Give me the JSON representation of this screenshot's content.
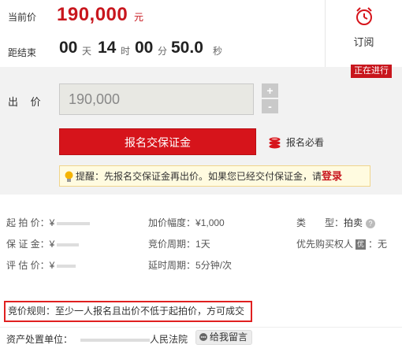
{
  "price": {
    "label": "当前价",
    "value": "190,000",
    "unit": "元"
  },
  "countdown": {
    "label": "距结束",
    "days": "00",
    "days_unit": "天",
    "hours": "14",
    "hours_unit": "时",
    "minutes": "00",
    "minutes_unit": "分",
    "seconds": "50.0",
    "seconds_unit": "秒"
  },
  "subscribe": {
    "label": "订阅",
    "icon": "alarm-clock-icon"
  },
  "status": "正在进行",
  "bid": {
    "label": "出 价",
    "input_value": "190,000",
    "plus": "+",
    "minus": "-",
    "register_button": "报名交保证金",
    "must_read": "报名必看",
    "tip_text": "提醒：先报名交保证金再出价。如果您已经交付保证金，请",
    "tip_link": "登录"
  },
  "details": {
    "start_price": {
      "label": "起 拍 价：",
      "value": "¥"
    },
    "deposit": {
      "label": "保 证 金：",
      "value": "¥"
    },
    "appraisal": {
      "label": "评 估 价：",
      "value": "¥"
    },
    "increment": {
      "label": "加价幅度：",
      "value": "¥1,000"
    },
    "cycle": {
      "label": "竞价周期：",
      "value": "1天"
    },
    "extension": {
      "label": "延时周期：",
      "value": "5分钟/次"
    },
    "type": {
      "label": "类　　型：",
      "value": "拍卖"
    },
    "priority": {
      "label": "优先购买权人",
      "badge": "优",
      "value": "：无"
    }
  },
  "rule": {
    "text": "竞价规则：至少一人报名且出价不低于起拍价，方可成交"
  },
  "owner": {
    "label": "资产处置单位：",
    "value": "人民法院",
    "message_button": "给我留言"
  },
  "colors": {
    "accent": "#d6141b",
    "panel_bg": "#f2f2f2",
    "tip_bg": "#fffbe0"
  }
}
